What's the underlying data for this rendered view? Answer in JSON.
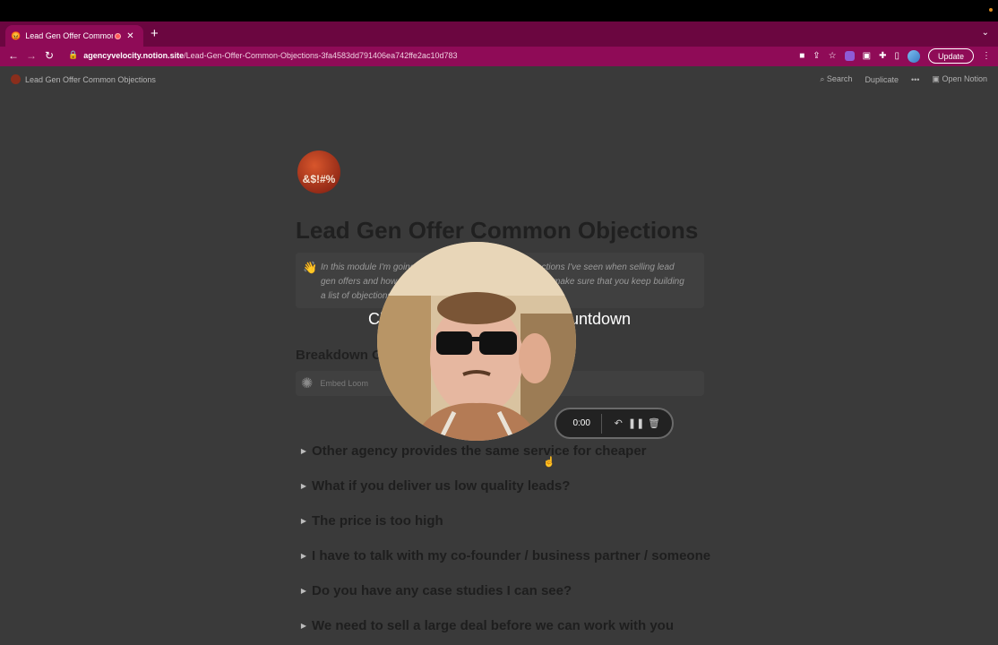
{
  "browser": {
    "tab": {
      "title": "Lead Gen Offer Common O",
      "close_icon": "✕"
    },
    "new_tab_icon": "+",
    "url_host": "agencyvelocity.notion.site",
    "url_path": "/Lead-Gen-Offer-Common-Objections-3fa4583dd791406ea742ffe2ac10d783",
    "update_label": "Update"
  },
  "notion": {
    "breadcrumb": "Lead Gen Offer Common Objections",
    "search_label": "Search",
    "duplicate_label": "Duplicate",
    "more_label": "•••",
    "open_notion_label": "Open Notion",
    "page_emoji_text": "&$!#%",
    "page_title": "Lead Gen Offer Common Objections",
    "callout": {
      "icon": "👋",
      "text": "In this module I'm going to go through the common objections I've seen when selling lead gen offers and how to overcome them. I encourage you to make sure that you keep building a list of objections that you"
    },
    "section_heading": "Breakdown Of",
    "embed_label": "Embed Loom",
    "toggles": [
      "Other agency provides the same service for cheaper",
      "What if you deliver us low quality leads?",
      "The price is too high",
      "I have to talk with my co-founder / business partner / someone",
      "Do you have any case studies I can see?",
      "We need to sell a large deal before we can work with you"
    ]
  },
  "overlay": {
    "countdown_left": "Cl",
    "countdown_right": "ountdown"
  },
  "recorder": {
    "time": "0:00"
  }
}
